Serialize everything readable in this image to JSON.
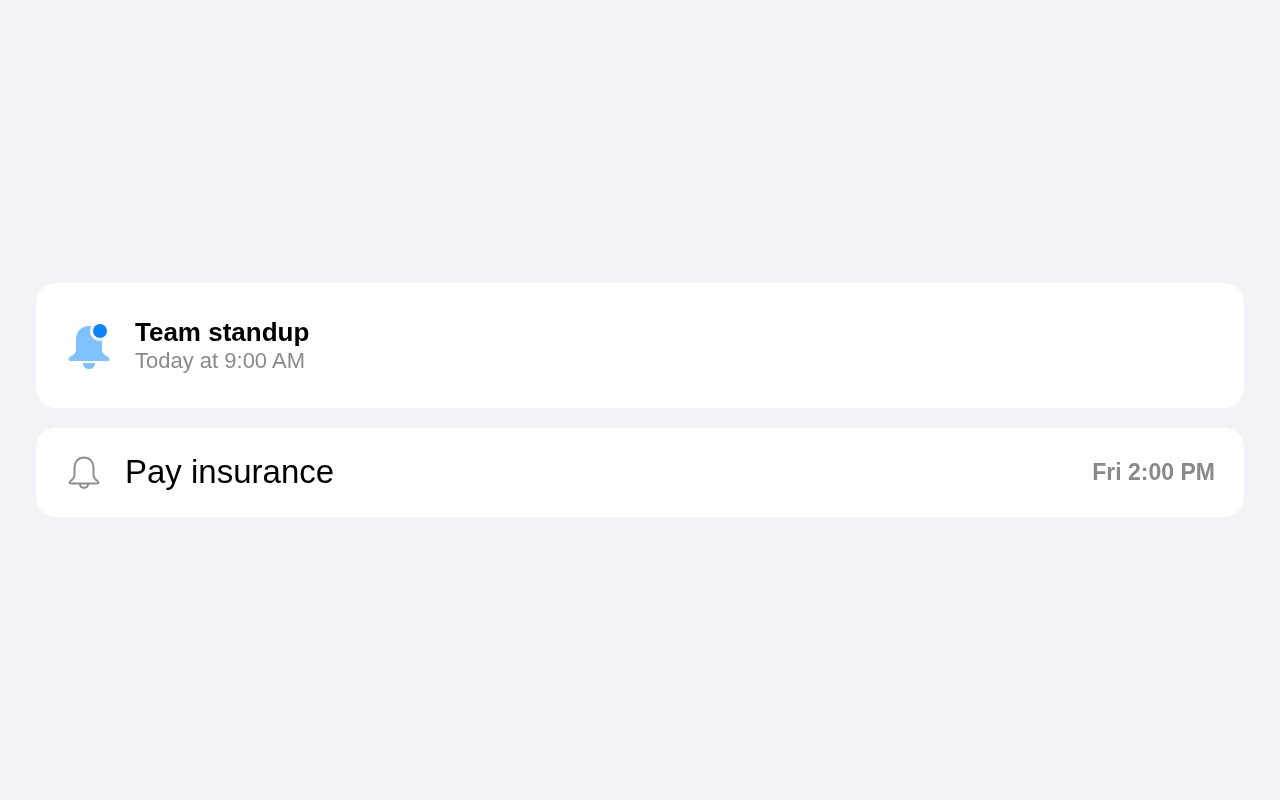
{
  "reminders": [
    {
      "kind": "detailed",
      "title": "Team standup",
      "subtitle": "Today at 9:00 AM",
      "unread": true
    },
    {
      "kind": "compact",
      "title": "Pay insurance",
      "time": "Fri 2:00 PM",
      "unread": false
    }
  ]
}
